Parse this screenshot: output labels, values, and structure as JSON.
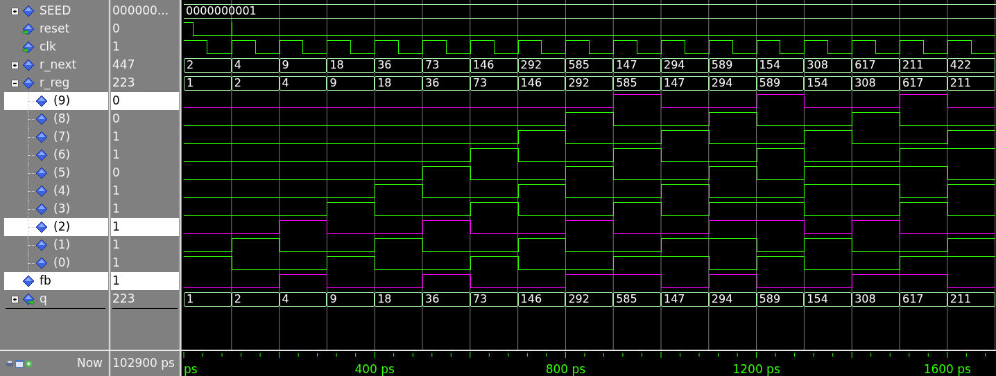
{
  "signals": [
    {
      "name": "SEED",
      "value": "000000...",
      "expanded": false,
      "selected": false,
      "kind": "bus",
      "segments": [
        "0000000001"
      ]
    },
    {
      "name": "reset",
      "value": "0",
      "input": true,
      "selected": false,
      "kind": "pulse",
      "high": [
        true,
        false,
        false,
        false,
        false,
        false,
        false,
        false,
        false,
        false,
        false,
        false,
        false,
        false,
        false,
        false,
        false
      ]
    },
    {
      "name": "clk",
      "value": "1",
      "input": true,
      "selected": false,
      "kind": "clock"
    },
    {
      "name": "r_next",
      "value": "447",
      "expanded": false,
      "selected": false,
      "kind": "bus",
      "segments": [
        "2",
        "4",
        "9",
        "18",
        "36",
        "73",
        "146",
        "292",
        "585",
        "147",
        "294",
        "589",
        "154",
        "308",
        "617",
        "211",
        "422"
      ]
    },
    {
      "name": "r_reg",
      "value": "223",
      "expanded": true,
      "selected": false,
      "kind": "bus",
      "segments": [
        "1",
        "2",
        "4",
        "9",
        "18",
        "36",
        "73",
        "146",
        "292",
        "585",
        "147",
        "294",
        "589",
        "154",
        "308",
        "617",
        "211"
      ],
      "children": [
        {
          "name": "(9)",
          "value": "0",
          "selected": true,
          "kind": "bit",
          "high": [
            false,
            false,
            false,
            false,
            false,
            false,
            false,
            false,
            false,
            true,
            false,
            false,
            true,
            false,
            false,
            true,
            false
          ]
        },
        {
          "name": "(8)",
          "value": "0",
          "selected": false,
          "kind": "bit",
          "high": [
            false,
            false,
            false,
            false,
            false,
            false,
            false,
            false,
            true,
            false,
            false,
            true,
            false,
            false,
            true,
            false,
            false
          ]
        },
        {
          "name": "(7)",
          "value": "1",
          "selected": false,
          "kind": "bit",
          "high": [
            false,
            false,
            false,
            false,
            false,
            false,
            false,
            true,
            false,
            false,
            true,
            false,
            false,
            true,
            false,
            false,
            true
          ]
        },
        {
          "name": "(6)",
          "value": "1",
          "selected": false,
          "kind": "bit",
          "high": [
            false,
            false,
            false,
            false,
            false,
            false,
            true,
            false,
            false,
            true,
            false,
            false,
            true,
            false,
            false,
            true,
            true
          ]
        },
        {
          "name": "(5)",
          "value": "0",
          "selected": false,
          "kind": "bit",
          "high": [
            false,
            false,
            false,
            false,
            false,
            true,
            false,
            false,
            true,
            false,
            false,
            true,
            false,
            true,
            true,
            true,
            false
          ]
        },
        {
          "name": "(4)",
          "value": "1",
          "selected": false,
          "kind": "bit",
          "high": [
            false,
            false,
            false,
            false,
            true,
            false,
            false,
            true,
            false,
            false,
            true,
            false,
            false,
            true,
            true,
            false,
            true
          ]
        },
        {
          "name": "(3)",
          "value": "1",
          "selected": false,
          "kind": "bit",
          "high": [
            false,
            false,
            false,
            true,
            false,
            false,
            true,
            false,
            false,
            true,
            false,
            true,
            true,
            false,
            false,
            true,
            false
          ]
        },
        {
          "name": "(2)",
          "value": "1",
          "selected": true,
          "kind": "bit",
          "high": [
            false,
            false,
            true,
            false,
            false,
            true,
            false,
            false,
            true,
            false,
            false,
            true,
            true,
            false,
            true,
            false,
            false
          ]
        },
        {
          "name": "(1)",
          "value": "1",
          "selected": false,
          "kind": "bit",
          "high": [
            false,
            true,
            false,
            false,
            true,
            false,
            false,
            true,
            false,
            false,
            true,
            true,
            false,
            true,
            false,
            false,
            true
          ]
        },
        {
          "name": "(0)",
          "value": "1",
          "selected": false,
          "kind": "bit",
          "high": [
            true,
            false,
            false,
            true,
            false,
            false,
            true,
            false,
            false,
            true,
            true,
            false,
            true,
            false,
            false,
            true,
            true
          ]
        }
      ]
    },
    {
      "name": "fb",
      "value": "1",
      "selected": true,
      "kind": "bit",
      "high": [
        false,
        false,
        true,
        false,
        false,
        true,
        false,
        false,
        true,
        true,
        false,
        true,
        false,
        false,
        true,
        true,
        false
      ]
    },
    {
      "name": "q",
      "value": "223",
      "expanded": false,
      "output": true,
      "selected": false,
      "kind": "bus",
      "segments": [
        "1",
        "2",
        "4",
        "9",
        "18",
        "36",
        "73",
        "146",
        "292",
        "585",
        "147",
        "294",
        "589",
        "154",
        "308",
        "617",
        "211"
      ]
    }
  ],
  "now": {
    "label": "Now",
    "value": "102900 ps"
  },
  "timeline": {
    "labels": [
      "ps",
      "400 ps",
      "800 ps",
      "1200 ps",
      "1600 ps"
    ]
  }
}
